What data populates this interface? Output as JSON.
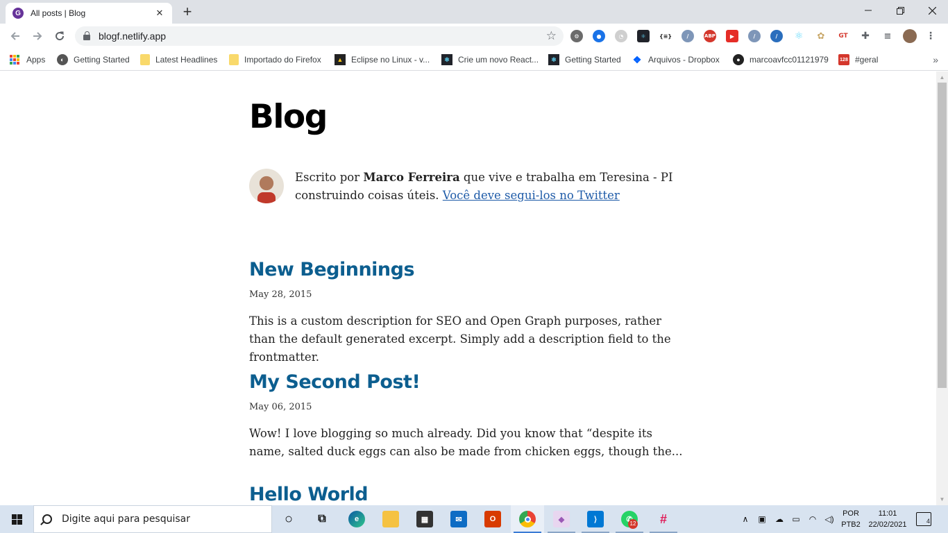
{
  "browser": {
    "tab": {
      "title": "All posts | Blog"
    },
    "url": "blogf.netlify.app",
    "bookmarks": [
      {
        "label": "Apps"
      },
      {
        "label": "Getting Started"
      },
      {
        "label": "Latest Headlines"
      },
      {
        "label": "Importado do Firefox"
      },
      {
        "label": "Eclipse no Linux - v..."
      },
      {
        "label": "Crie um novo React..."
      },
      {
        "label": "Getting Started"
      },
      {
        "label": "Arquivos - Dropbox"
      },
      {
        "label": "marcoavfcc01121979"
      },
      {
        "label": "#geral"
      }
    ],
    "extensions": {
      "adblock": "ABP",
      "json": "{≡}"
    }
  },
  "page": {
    "title": "Blog",
    "bio": {
      "prefix": "Escrito por ",
      "author": "Marco Ferreira",
      "middle": " que vive e trabalha em Teresina - PI construindo coisas úteis. ",
      "link": "Você deve segui-los no Twitter"
    },
    "posts": [
      {
        "title": "New Beginnings",
        "date": "May 28, 2015",
        "description": "This is a custom description for SEO and Open Graph purposes, rather than the default generated excerpt. Simply add a description field to the frontmatter."
      },
      {
        "title": "My Second Post!",
        "date": "May 06, 2015",
        "description": "Wow! I love blogging so much already. Did you know that “despite its name, salted duck eggs can also be made from chicken eggs, though the..."
      },
      {
        "title": "Hello World",
        "date": "",
        "description": ""
      }
    ]
  },
  "taskbar": {
    "search_placeholder": "Digite aqui para pesquisar",
    "whatsapp_badge": "12",
    "language": "POR",
    "keyboard": "PTB2",
    "time": "11:01",
    "date": "22/02/2021",
    "notifications": "4",
    "bookmark_badge": "128"
  },
  "colors": {
    "post_title": "#0c5e8f",
    "link": "#1e5ba8",
    "tab_bar": "#dee1e6",
    "taskbar": "#d8e3f0"
  }
}
